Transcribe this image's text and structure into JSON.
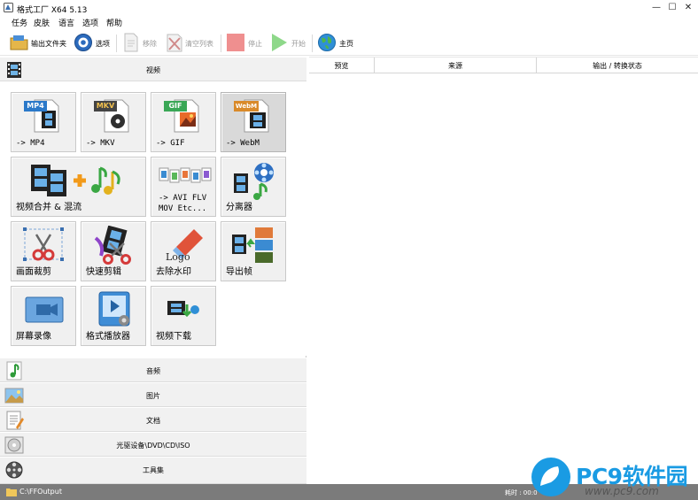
{
  "window": {
    "title": "格式工厂 X64 5.13",
    "controls": {
      "minimize": "—",
      "maximize": "☐",
      "close": "✕"
    }
  },
  "menu": [
    "任务",
    "皮肤",
    "语言",
    "选项",
    "帮助"
  ],
  "toolbar": {
    "output_folder": "输出文件夹",
    "options": "选项",
    "remove": "移除",
    "clear_list": "清空列表",
    "stop": "停止",
    "start": "开始",
    "home": "主页"
  },
  "categories": {
    "video": "视频",
    "audio": "音频",
    "image": "图片",
    "document": "文档",
    "disc": "光驱设备\\DVD\\CD\\ISO",
    "tools": "工具集"
  },
  "video_tiles": {
    "mp4": {
      "badge": "MP4",
      "label": "-> MP4"
    },
    "mkv": {
      "badge": "MKV",
      "label": "-> MKV"
    },
    "gif": {
      "badge": "GIF",
      "label": "-> GIF"
    },
    "webm": {
      "badge": "WebM",
      "label": "-> WebM"
    },
    "join": {
      "label": "视频合并 & 混流"
    },
    "avi": {
      "line1": "-> AVI FLV",
      "line2": "MOV Etc..."
    },
    "splitter": {
      "label": "分离器"
    },
    "crop": {
      "label": "画面裁剪"
    },
    "quickcut": {
      "label": "快速剪辑"
    },
    "delogo": {
      "label": "去除水印",
      "logo_text": "Logo"
    },
    "frames": {
      "label": "导出帧"
    },
    "screenrec": {
      "label": "屏幕录像"
    },
    "player": {
      "label": "格式播放器"
    },
    "download": {
      "label": "视频下载"
    }
  },
  "task_list": {
    "columns": [
      "预览",
      "来源",
      "输出 / 转换状态"
    ]
  },
  "status": {
    "output_path": "C:\\FFOutput",
    "elapsed": "耗时 : 00:0"
  },
  "watermark": {
    "brand": "PC9软件园",
    "url": "www.pc9.com"
  },
  "colors": {
    "accent_blue": "#1a9be3",
    "statusbar": "#7b7b7b",
    "mp4_badge": "#2b79c9",
    "mkv_badge": "#444444",
    "gif_badge": "#3aa756",
    "webm_badge": "#d98a2a"
  }
}
